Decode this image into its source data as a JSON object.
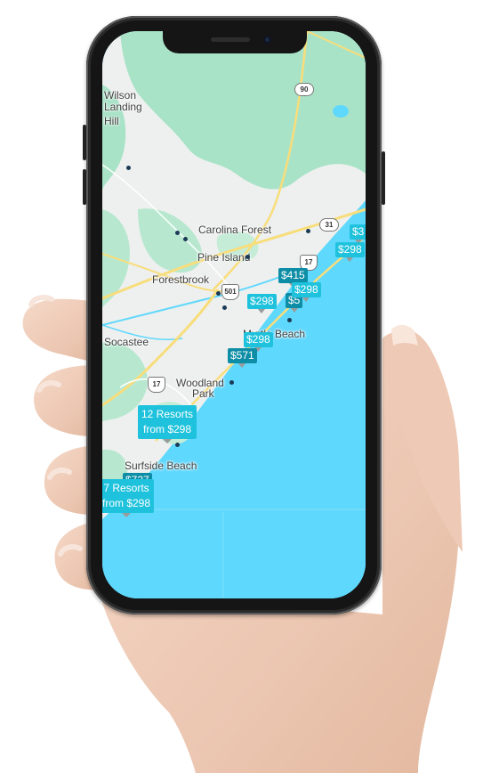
{
  "map": {
    "place_labels": [
      {
        "id": "wilson",
        "text": "Wilson"
      },
      {
        "id": "landing",
        "text": "Landing"
      },
      {
        "id": "hill",
        "text": "Hill"
      },
      {
        "id": "carolina-forest",
        "text": "Carolina Forest"
      },
      {
        "id": "pine-island",
        "text": "Pine Island"
      },
      {
        "id": "forestbrook",
        "text": "Forestbrook"
      },
      {
        "id": "socastee",
        "text": "Socastee"
      },
      {
        "id": "myrtle-beach",
        "text": "Myrtle Beach"
      },
      {
        "id": "woodland",
        "text": "Woodland"
      },
      {
        "id": "park",
        "text": "Park"
      },
      {
        "id": "surfside-beach",
        "text": "Surfside Beach"
      }
    ],
    "route_shields": [
      "90",
      "31",
      "17",
      "501",
      "17"
    ],
    "price_markers": [
      "$298",
      "$415",
      "$298",
      "$298",
      "$298",
      "$571",
      "$298",
      "$5",
      "$3",
      "$727"
    ],
    "clusters": [
      {
        "line1": "12 Resorts",
        "line2": "from $298"
      },
      {
        "line1": "7 Resorts",
        "line2": "from $298"
      }
    ],
    "colors": {
      "water": "#5fd8fd",
      "land": "#eef0ef",
      "forest": "#a9e3c7",
      "road": "#f8dd7b",
      "marker": "#1fc2dc",
      "marker_dark": "#0e8ea6"
    }
  }
}
